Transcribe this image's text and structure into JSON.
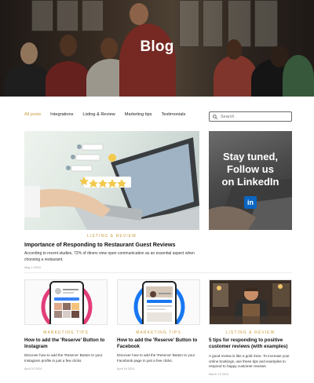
{
  "hero": {
    "title": "Blog"
  },
  "filters": [
    {
      "label": "All posts",
      "active": true
    },
    {
      "label": "Integrations",
      "active": false
    },
    {
      "label": "Listing & Review",
      "active": false
    },
    {
      "label": "Marketing tips",
      "active": false
    },
    {
      "label": "Testimonials",
      "active": false
    }
  ],
  "search": {
    "placeholder": "Search"
  },
  "featured": {
    "category": "LISTING & REVIEW",
    "title": "Importance of Responding to Restaurant Guest Reviews",
    "excerpt": "According to recent studies, 72% of diners view open communication as an essential aspect when choosing a restaurant.",
    "date": "May 1 2024"
  },
  "ad": {
    "line1": "Stay tuned,",
    "line2": "Follow us",
    "line3": "on LinkedIn",
    "badge": "in"
  },
  "cards": [
    {
      "category": "MARKETING TIPS",
      "title": "How to add the 'Reserve' Button to Instagram",
      "excerpt": "Discover how to add the 'Reserve' Button to your Instagram profile in just a few clicks.",
      "date": "April 24 2024",
      "accent": "#e23d7a"
    },
    {
      "category": "MARKETING TIPS",
      "title": "How to add the 'Reserve' Button to Facebook",
      "excerpt": "Discover how to add the 'Reserve' Button to your Facebook page in just a few clicks.",
      "date": "April 18 2024",
      "accent": "#1877f2"
    },
    {
      "category": "LISTING & REVIEW",
      "title": "5 tips for responding to positive customer reviews (with examples)",
      "excerpt": "A good review is like a gold mine. To increase your online bookings, use these tips and examples to respond to happy customer reviews.",
      "date": "March 19 2024"
    }
  ],
  "colors": {
    "accent": "#c89b3c",
    "linkedin": "#0a66c2"
  }
}
